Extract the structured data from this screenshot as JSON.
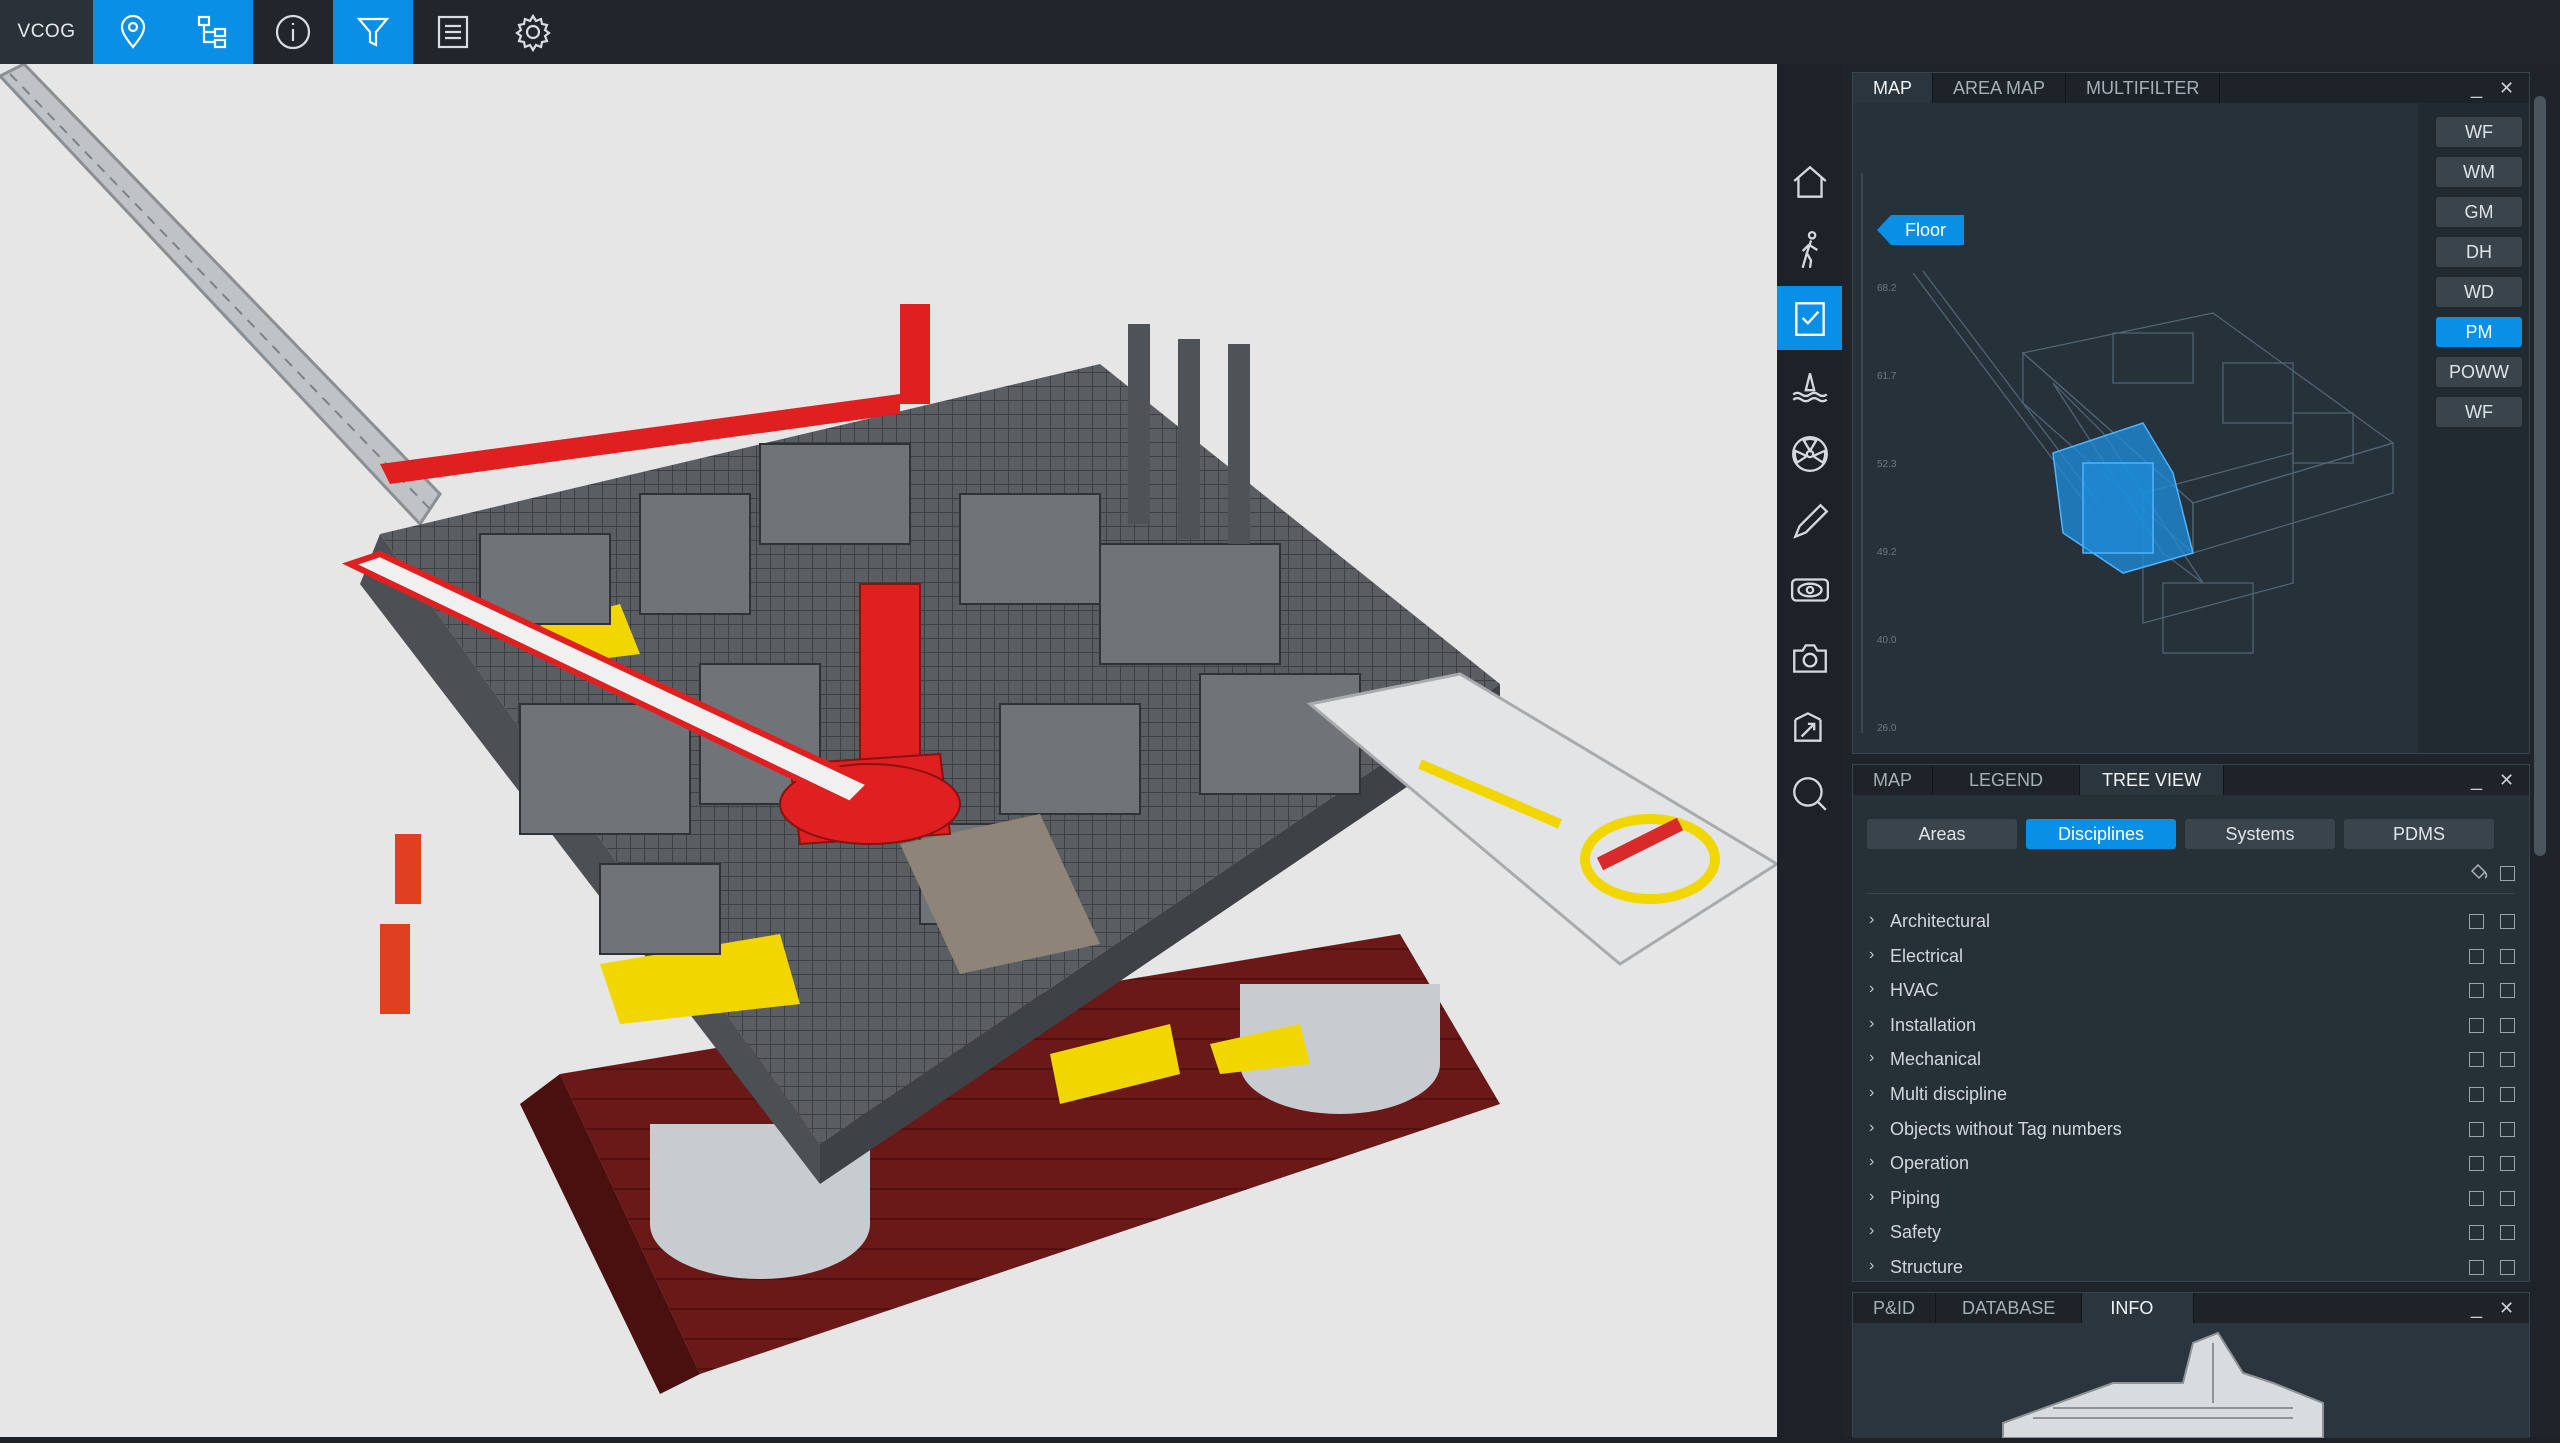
{
  "topbar": {
    "brand": "VCOG",
    "buttons": [
      {
        "name": "location-pin-button",
        "icon": "location-pin-icon",
        "active": true
      },
      {
        "name": "hierarchy-tree-button",
        "icon": "hierarchy-tree-icon",
        "active": true
      },
      {
        "name": "info-button",
        "icon": "info-circle-icon",
        "active": false
      },
      {
        "name": "filter-button",
        "icon": "filter-funnel-icon",
        "active": true
      },
      {
        "name": "list-document-button",
        "icon": "document-list-icon",
        "active": false
      },
      {
        "name": "settings-button",
        "icon": "gear-icon",
        "active": false
      }
    ]
  },
  "sidebar": {
    "items": [
      {
        "name": "home",
        "icon": "home-icon",
        "active": false
      },
      {
        "name": "walk-mode",
        "icon": "walking-person-icon",
        "active": false
      },
      {
        "name": "notes",
        "icon": "clipboard-check-icon",
        "active": true
      },
      {
        "name": "water-level",
        "icon": "water-level-icon",
        "active": false
      },
      {
        "name": "hazard",
        "icon": "radiation-icon",
        "active": false
      },
      {
        "name": "draw",
        "icon": "pencil-icon",
        "active": false
      },
      {
        "name": "view",
        "icon": "eye-icon",
        "active": false
      },
      {
        "name": "screenshot",
        "icon": "camera-icon",
        "active": false
      },
      {
        "name": "export",
        "icon": "box-export-icon",
        "active": false
      },
      {
        "name": "search",
        "icon": "magnifier-icon",
        "active": false
      }
    ]
  },
  "map_panel": {
    "tabs": [
      "MAP",
      "AREA MAP",
      "MULTIFILTER"
    ],
    "active_tab": "MAP",
    "minimize": "_",
    "close": "✕",
    "floor_label": "Floor",
    "levels_axis": [
      "68.2",
      "61.7",
      "52.3",
      "49.2",
      "40.0",
      "26.0"
    ],
    "level_buttons": [
      "WF",
      "WM",
      "GM",
      "DH",
      "WD",
      "PM",
      "POWW",
      "WF"
    ],
    "active_level": "PM"
  },
  "tree_panel": {
    "tabs": [
      "MAP",
      "LEGEND",
      "TREE VIEW"
    ],
    "active_tab": "TREE VIEW",
    "minimize": "_",
    "close": "✕",
    "segments": [
      "Areas",
      "Disciplines",
      "Systems",
      "PDMS"
    ],
    "active_segment": "Disciplines",
    "items": [
      "Architectural",
      "Electrical",
      "HVAC",
      "Installation",
      "Mechanical",
      "Multi discipline",
      "Objects without Tag numbers",
      "Operation",
      "Piping",
      "Safety",
      "Structure"
    ]
  },
  "info_panel": {
    "tabs": [
      "P&ID",
      "DATABASE",
      "INFO"
    ],
    "active_tab": "INFO",
    "minimize": "_",
    "close": "✕"
  },
  "colors": {
    "accent": "#0a8fe6",
    "crane_red": "#e02020",
    "deck_yellow": "#f2d600",
    "hull_red": "#6a1818"
  }
}
